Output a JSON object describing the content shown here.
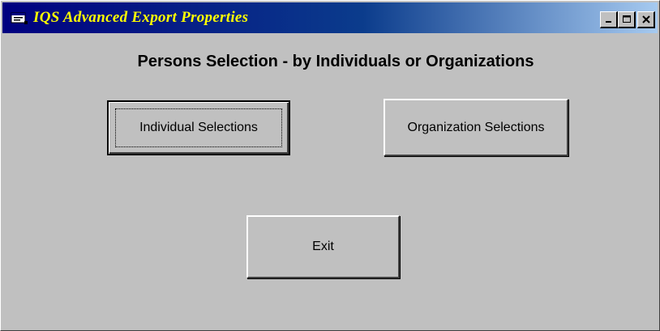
{
  "window": {
    "title": "IQS Advanced Export Properties",
    "title_color": "#ffff00",
    "titlebar_color": "#000080",
    "app_icon": "app-window-icon",
    "controls": {
      "minimize_icon": "minimize-icon",
      "maximize_icon": "maximize-icon",
      "close_icon": "close-icon"
    }
  },
  "main": {
    "heading": "Persons Selection - by Individuals or Organizations",
    "buttons": {
      "individual": "Individual Selections",
      "organization": "Organization Selections",
      "exit": "Exit"
    }
  }
}
